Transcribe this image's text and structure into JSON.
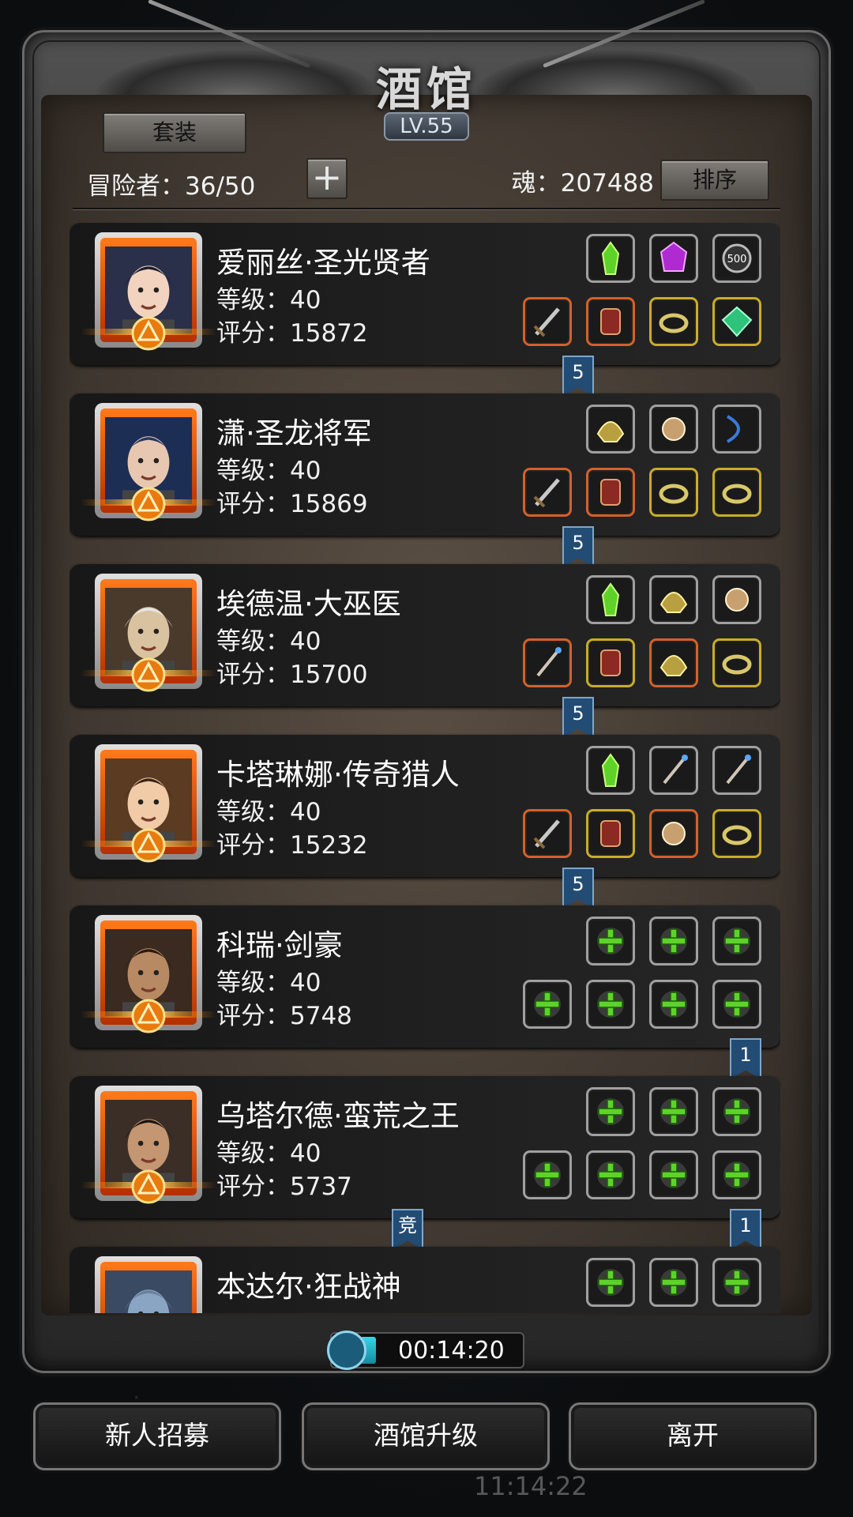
{
  "title": "酒馆",
  "level": "LV.55",
  "header": {
    "suit_label": "套装",
    "adventurer_label": "冒险者：36/50",
    "add_label": "+",
    "soul_label": "魂：207488",
    "sort_label": "排序"
  },
  "heroes": [
    {
      "name": "爱丽丝·圣光贤者",
      "level": "等级：40",
      "score": "评分：15872",
      "badge": "5"
    },
    {
      "name": "潇·圣龙将军",
      "level": "等级：40",
      "score": "评分：15869",
      "badge": "5"
    },
    {
      "name": "埃德温·大巫医",
      "level": "等级：40",
      "score": "评分：15700",
      "badge": "5"
    },
    {
      "name": "卡塔琳娜·传奇猎人",
      "level": "等级：40",
      "score": "评分：15232",
      "badge": "5"
    },
    {
      "name": "科瑞·剑豪",
      "level": "等级：40",
      "score": "评分：5748",
      "badge": "1"
    },
    {
      "name": "乌塔尔德·蛮荒之王",
      "level": "等级：40",
      "score": "评分：5737",
      "badge": "1",
      "tag": "竞"
    },
    {
      "name": "本达尔·狂战神",
      "level": "",
      "score": ""
    }
  ],
  "timer": {
    "text": "00:14:20",
    "progress": 0.1
  },
  "buttons": {
    "recruit": "新人招募",
    "upgrade": "酒馆升级",
    "leave": "离开"
  },
  "background_clock": "11:14:22",
  "colors": {
    "slot_orange": "#d4612a",
    "slot_gold": "#c9ac2c",
    "ribbon_blue": "#234c74",
    "timer_cyan": "#37d5e8",
    "empty_plus": "#5fd22a"
  }
}
